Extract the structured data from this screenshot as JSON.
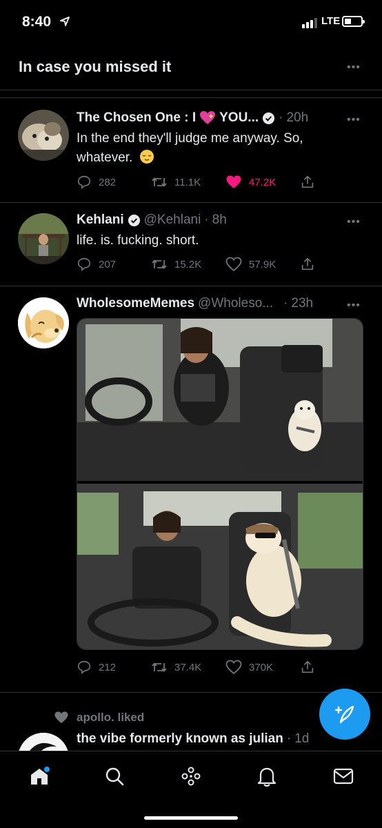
{
  "status_bar": {
    "time": "8:40",
    "network": "LTE"
  },
  "section": {
    "title": "In case you missed it"
  },
  "tweets": [
    {
      "name": "The Chosen One : I",
      "name_suffix": "YOU...",
      "time": "20h",
      "text": "In the end they'll judge me anyway. So, whatever.",
      "replies": "282",
      "retweets": "11.1K",
      "likes": "47.2K",
      "liked": true
    },
    {
      "name": "Kehlani",
      "handle": "@Kehlani",
      "time": "8h",
      "text": "life. is. fucking. short.",
      "replies": "207",
      "retweets": "15.2K",
      "likes": "57.9K"
    },
    {
      "name": "WholesomeMemes",
      "handle": "@Wholeso...",
      "time": "23h",
      "replies": "212",
      "retweets": "37.4K",
      "likes": "370K"
    }
  ],
  "liked_context": {
    "text": "apollo. liked"
  },
  "partial_tweet": {
    "name": "the vibe formerly known as julian",
    "time": "1d"
  },
  "icons": [
    "location-arrow-icon",
    "more-icon",
    "reply-icon",
    "retweet-icon",
    "heart-icon",
    "share-icon",
    "verified-icon",
    "compose-icon",
    "home-icon",
    "search-icon",
    "spaces-icon",
    "notifications-icon",
    "messages-icon"
  ],
  "colors": {
    "accent": "#1d9bf0",
    "like": "#f91880",
    "muted": "#71767b",
    "background": "#000000"
  }
}
